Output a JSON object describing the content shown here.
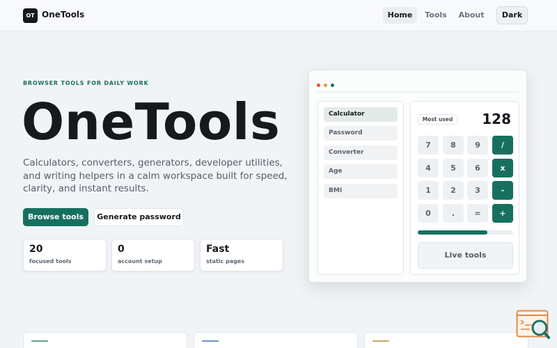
{
  "nav": {
    "logo_text": "OT",
    "brand": "OneTools",
    "links": [
      "Home",
      "Tools",
      "About"
    ],
    "active_link": "Home",
    "theme_toggle": "Dark"
  },
  "hero": {
    "eyebrow": "BROWSER TOOLS FOR DAILY WORK",
    "title": "OneTools",
    "description": "Calculators, converters, generators, developer utilities, and writing helpers in a calm workspace built for speed, clarity, and instant results.",
    "primary_button": "Browse tools",
    "secondary_button": "Generate password",
    "stats": [
      {
        "value": "20",
        "label": "focused tools"
      },
      {
        "value": "0",
        "label": "account setup"
      },
      {
        "value": "Fast",
        "label": "static pages"
      }
    ]
  },
  "preview": {
    "window_dots": [
      "#e0573f",
      "#d9a23a",
      "#17705f"
    ],
    "sidebar": [
      "Calculator",
      "Password",
      "Converter",
      "Age",
      "BMI"
    ],
    "active_sidebar": "Calculator",
    "badge": "Most used",
    "display": "128",
    "keypad": [
      [
        "7",
        "8",
        "9",
        "/"
      ],
      [
        "4",
        "5",
        "6",
        "x"
      ],
      [
        "1",
        "2",
        "3",
        "-"
      ],
      [
        "0",
        ".",
        "=",
        "+"
      ]
    ],
    "progress": 0.73,
    "live_label": "Live tools"
  },
  "cards": {
    "accents": [
      "#5fa38f",
      "#6a8fc9",
      "#c8a561"
    ]
  },
  "colors": {
    "accent": "#17705f",
    "background": "#f1f4f7",
    "text": "#16191d"
  },
  "widget": {
    "icon": "search-code-icon"
  }
}
